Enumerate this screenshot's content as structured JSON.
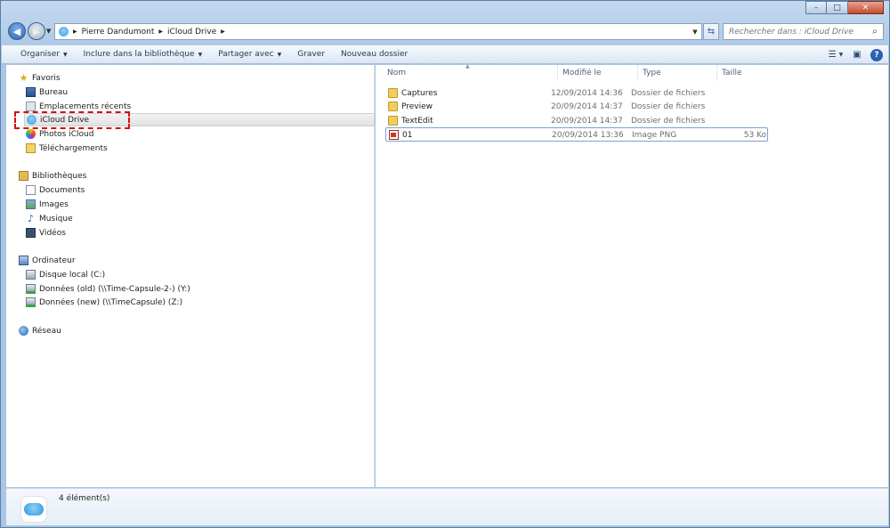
{
  "window": {
    "caption": {
      "minimize": "–",
      "maximize": "□",
      "close": "✕"
    }
  },
  "address_bar": {
    "crumbs": [
      "Pierre Dandumont",
      "iCloud Drive"
    ],
    "search_placeholder": "Rechercher dans : iCloud Drive"
  },
  "toolbar": {
    "organize": "Organiser",
    "include_library": "Inclure dans la bibliothèque",
    "share_with": "Partager avec",
    "burn": "Graver",
    "new_folder": "Nouveau dossier"
  },
  "nav": {
    "favorites": {
      "title": "Favoris",
      "items": [
        "Bureau",
        "Emplacements récents",
        "iCloud Drive",
        "Photos iCloud",
        "Téléchargements"
      ]
    },
    "libraries": {
      "title": "Bibliothèques",
      "items": [
        "Documents",
        "Images",
        "Musique",
        "Vidéos"
      ]
    },
    "computer": {
      "title": "Ordinateur",
      "items": [
        "Disque local (C:)",
        "Données (old) (\\\\Time-Capsule-2-) (Y:)",
        "Données (new) (\\\\TimeCapsule) (Z:)"
      ]
    },
    "network": {
      "title": "Réseau"
    },
    "selected": "iCloud Drive"
  },
  "columns": {
    "name": "Nom",
    "modified": "Modifié le",
    "type": "Type",
    "size": "Taille"
  },
  "files": [
    {
      "name": "Captures",
      "modified": "12/09/2014 14:36",
      "type": "Dossier de fichiers",
      "size": ""
    },
    {
      "name": "Preview",
      "modified": "20/09/2014 14:37",
      "type": "Dossier de fichiers",
      "size": ""
    },
    {
      "name": "TextEdit",
      "modified": "20/09/2014 14:37",
      "type": "Dossier de fichiers",
      "size": ""
    },
    {
      "name": "01",
      "modified": "20/09/2014 13:36",
      "type": "Image PNG",
      "size": "53 Ko"
    }
  ],
  "status": {
    "count": "4 élément(s)"
  },
  "colors": {
    "highlight": "#d01010",
    "accent": "#2a62b1"
  }
}
